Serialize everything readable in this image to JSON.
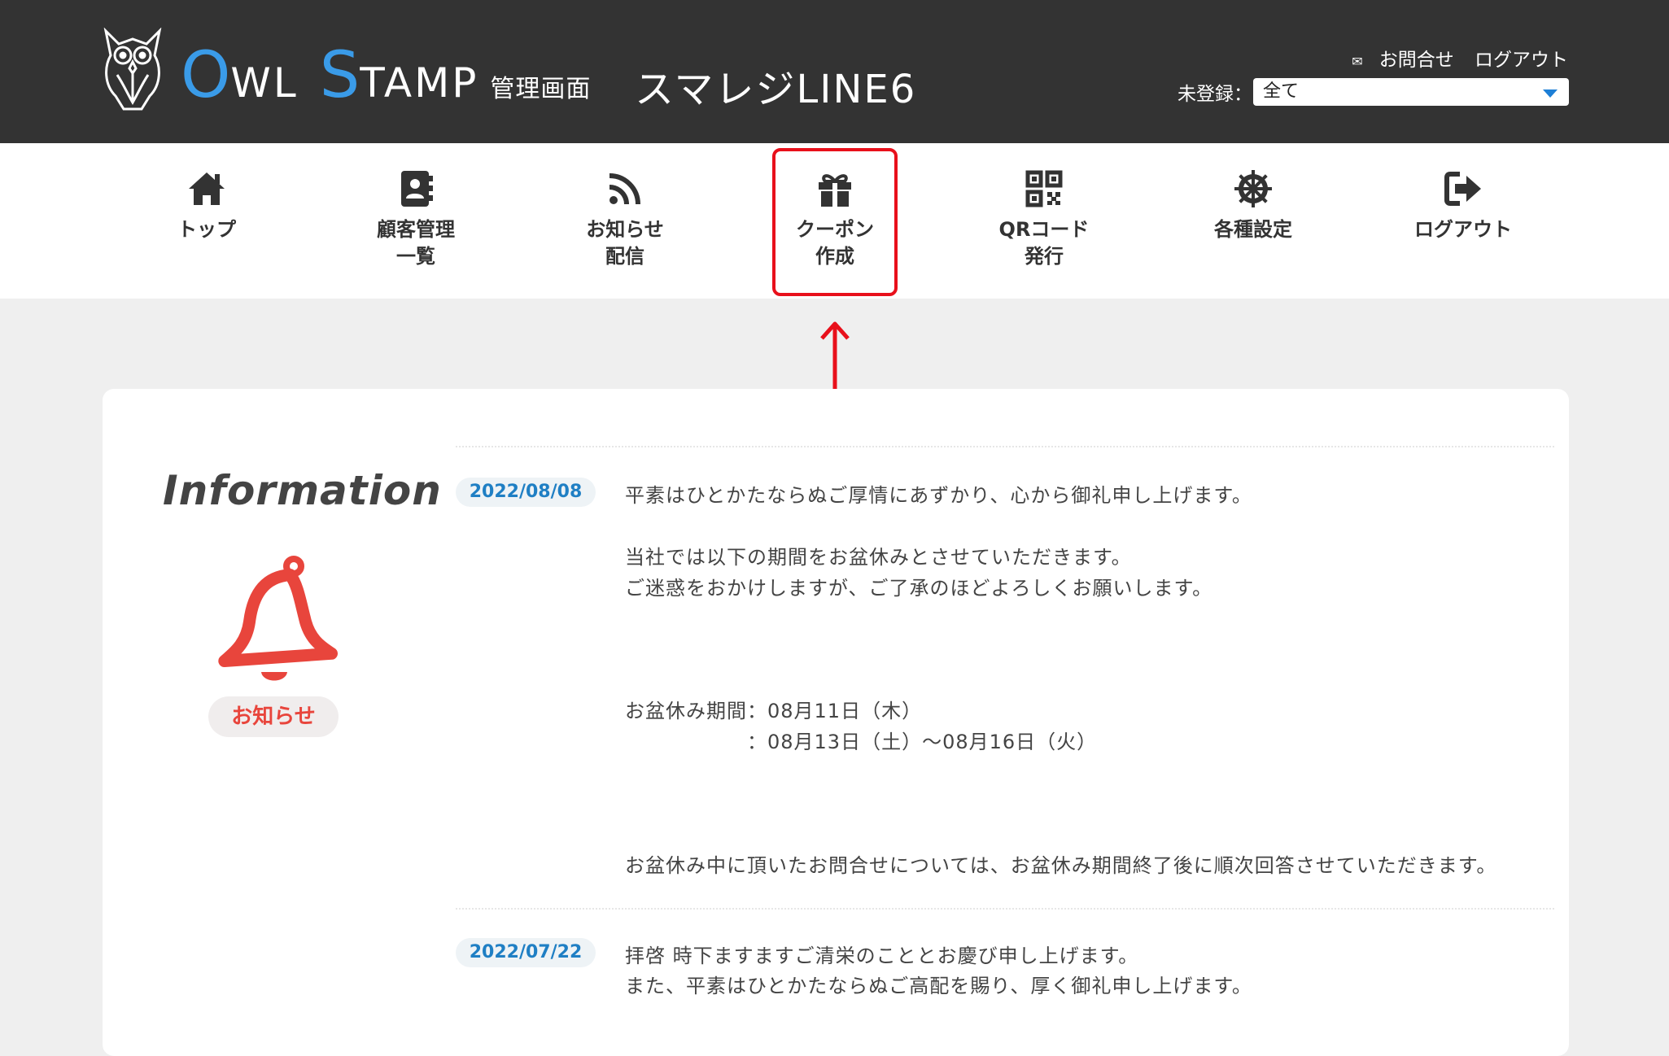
{
  "header": {
    "brand_o": "O",
    "brand_wl": "WL",
    "brand_s": "S",
    "brand_tamp": "TAMP",
    "brand_subtitle": "管理画面",
    "shop_name": "スマレジLINE6",
    "contact_label": "お問合せ",
    "logout_label": "ログアウト",
    "filter_label": "未登録：",
    "filter_value": "全て"
  },
  "nav": {
    "items": [
      {
        "line1": "トップ",
        "line2": "",
        "icon": "home-icon"
      },
      {
        "line1": "顧客管理",
        "line2": "一覧",
        "icon": "address-book-icon"
      },
      {
        "line1": "お知らせ",
        "line2": "配信",
        "icon": "rss-icon"
      },
      {
        "line1": "クーポン",
        "line2": "作成",
        "icon": "gift-icon"
      },
      {
        "line1": "QRコード",
        "line2": "発行",
        "icon": "qrcode-icon"
      },
      {
        "line1": "各種設定",
        "line2": "",
        "icon": "helm-icon"
      },
      {
        "line1": "ログアウト",
        "line2": "",
        "icon": "sign-out-icon"
      }
    ]
  },
  "info": {
    "title": "Information",
    "badge": "お知らせ",
    "entries": [
      {
        "date": "2022/08/08",
        "lines": [
          "平素はひとかたならぬご厚情にあずかり、心から御礼申し上げます。",
          "当社では以下の期間をお盆休みとさせていただきます。",
          "ご迷惑をおかけしますが、ご了承のほどよろしくお願いします。",
          "お盆休み期間：08月11日（木）",
          "：08月13日（土）〜08月16日（火）",
          "お盆休み中に頂いたお問合せについては、お盆休み期間終了後に順次回答させていただきます。"
        ]
      },
      {
        "date": "2022/07/22",
        "lines": [
          "拝啓 時下ますますご清栄のこととお慶び申し上げます。",
          "また、平素はひとかたならぬご高配を賜り、厚く御礼申し上げます。"
        ]
      }
    ]
  },
  "colors": {
    "header_bg": "#333333",
    "brand_blue": "#3a9be8",
    "highlight_red": "#e8101b",
    "bell_red": "#e8453c",
    "date_blue": "#1f7fc4"
  }
}
